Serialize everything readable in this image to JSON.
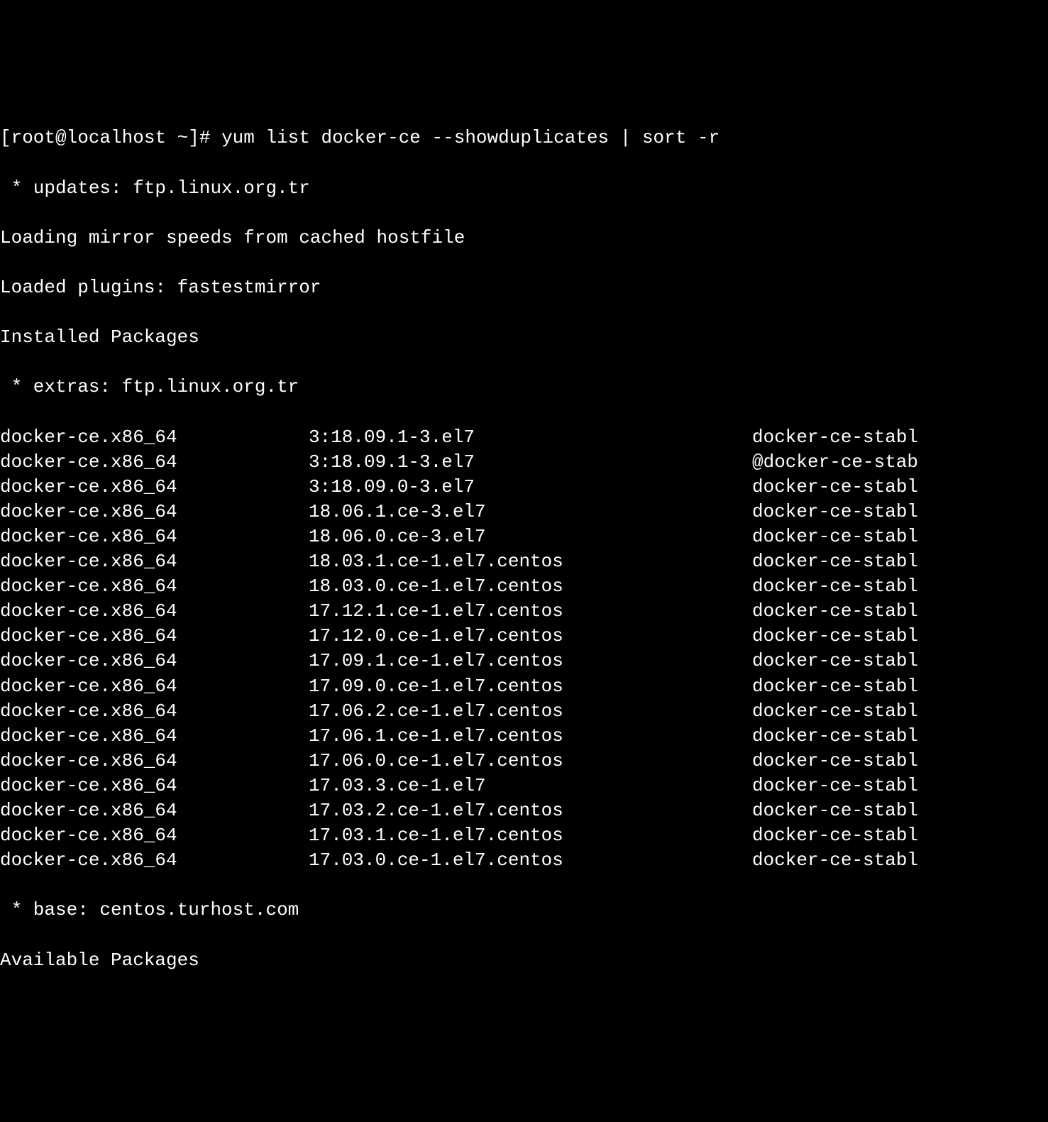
{
  "prompt": "[root@localhost ~]# ",
  "command": "yum list docker-ce --showduplicates | sort -r",
  "lines": {
    "updates": " * updates: ftp.linux.org.tr",
    "loading": "Loading mirror speeds from cached hostfile",
    "loaded": "Loaded plugins: fastestmirror",
    "installed": "Installed Packages",
    "extras": " * extras: ftp.linux.org.tr",
    "base": " * base: centos.turhost.com",
    "available": "Available Packages"
  },
  "packages": [
    {
      "name": "docker-ce.x86_64",
      "version": "3:18.09.1-3.el7",
      "repo": "docker-ce-stabl"
    },
    {
      "name": "docker-ce.x86_64",
      "version": "3:18.09.1-3.el7",
      "repo": "@docker-ce-stab"
    },
    {
      "name": "docker-ce.x86_64",
      "version": "3:18.09.0-3.el7",
      "repo": "docker-ce-stabl"
    },
    {
      "name": "docker-ce.x86_64",
      "version": "18.06.1.ce-3.el7",
      "repo": "docker-ce-stabl"
    },
    {
      "name": "docker-ce.x86_64",
      "version": "18.06.0.ce-3.el7",
      "repo": "docker-ce-stabl"
    },
    {
      "name": "docker-ce.x86_64",
      "version": "18.03.1.ce-1.el7.centos",
      "repo": "docker-ce-stabl"
    },
    {
      "name": "docker-ce.x86_64",
      "version": "18.03.0.ce-1.el7.centos",
      "repo": "docker-ce-stabl"
    },
    {
      "name": "docker-ce.x86_64",
      "version": "17.12.1.ce-1.el7.centos",
      "repo": "docker-ce-stabl"
    },
    {
      "name": "docker-ce.x86_64",
      "version": "17.12.0.ce-1.el7.centos",
      "repo": "docker-ce-stabl"
    },
    {
      "name": "docker-ce.x86_64",
      "version": "17.09.1.ce-1.el7.centos",
      "repo": "docker-ce-stabl"
    },
    {
      "name": "docker-ce.x86_64",
      "version": "17.09.0.ce-1.el7.centos",
      "repo": "docker-ce-stabl"
    },
    {
      "name": "docker-ce.x86_64",
      "version": "17.06.2.ce-1.el7.centos",
      "repo": "docker-ce-stabl"
    },
    {
      "name": "docker-ce.x86_64",
      "version": "17.06.1.ce-1.el7.centos",
      "repo": "docker-ce-stabl"
    },
    {
      "name": "docker-ce.x86_64",
      "version": "17.06.0.ce-1.el7.centos",
      "repo": "docker-ce-stabl"
    },
    {
      "name": "docker-ce.x86_64",
      "version": "17.03.3.ce-1.el7",
      "repo": "docker-ce-stabl"
    },
    {
      "name": "docker-ce.x86_64",
      "version": "17.03.2.ce-1.el7.centos",
      "repo": "docker-ce-stabl"
    },
    {
      "name": "docker-ce.x86_64",
      "version": "17.03.1.ce-1.el7.centos",
      "repo": "docker-ce-stabl"
    },
    {
      "name": "docker-ce.x86_64",
      "version": "17.03.0.ce-1.el7.centos",
      "repo": "docker-ce-stabl"
    }
  ]
}
